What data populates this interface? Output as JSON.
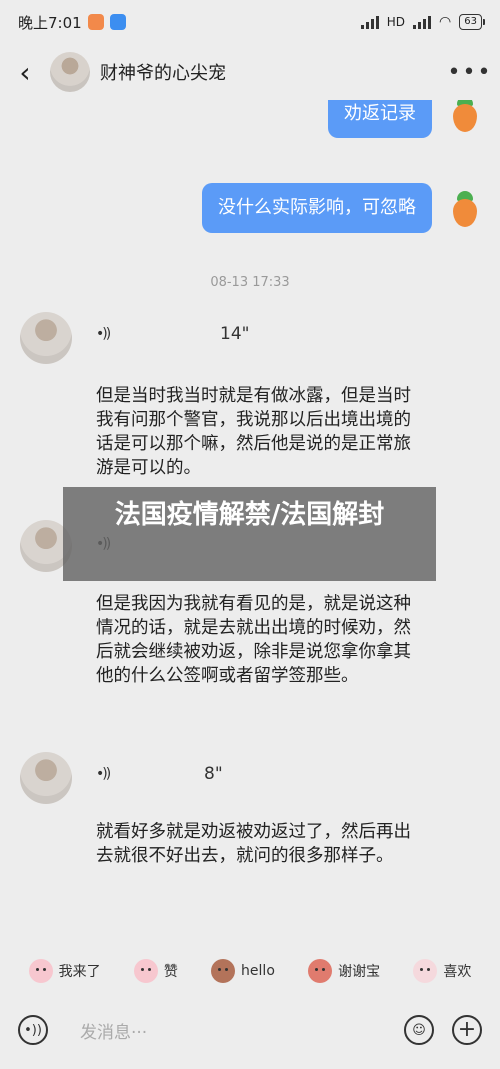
{
  "status_bar": {
    "time": "晚上7:01",
    "network": "HD",
    "battery": "63"
  },
  "header": {
    "back_icon": "chevron-left-icon",
    "title": "财神爷的心尖宠",
    "more": "•••"
  },
  "messages_out": [
    {
      "text": "劝返记录"
    },
    {
      "text": "没什么实际影响，可忽略"
    }
  ],
  "timestamp": "08-13 17:33",
  "voice_messages": [
    {
      "duration": "14\"",
      "transcript": "但是当时我当时就是有做冰露，但是当时我有问那个警官，我说那以后出境出境的话是可以那个嘛，然后他是说的是正常旅游是可以的。"
    },
    {
      "duration": "",
      "transcript": "但是我因为我就有看见的是，就是说这种情况的话，就是去就出出境的时候劝，然后就会继续被劝返，除非是说您拿你拿其他的什么公签啊或者留学签那些。"
    },
    {
      "duration": "8\"",
      "transcript": "就看好多就是劝返被劝返过了，然后再出去就很不好出去，就问的很多那样子。"
    }
  ],
  "overlay": {
    "text": "法国疫情解禁/法国解封"
  },
  "quick_replies": [
    {
      "label": "我来了",
      "color": "#f7c7cf"
    },
    {
      "label": "赞",
      "color": "#f7c7cf"
    },
    {
      "label": "hello",
      "color": "#b3735a"
    },
    {
      "label": "谢谢宝",
      "color": "#e07b6e"
    },
    {
      "label": "喜欢",
      "color": "#f5d9dd"
    }
  ],
  "input": {
    "placeholder": "发消息···",
    "voice_icon": "voice-icon",
    "emoji_icon": "emoji-icon",
    "plus_icon": "plus-icon"
  },
  "colors": {
    "bubble_out": "#5b9bf7",
    "background": "#ededed"
  }
}
